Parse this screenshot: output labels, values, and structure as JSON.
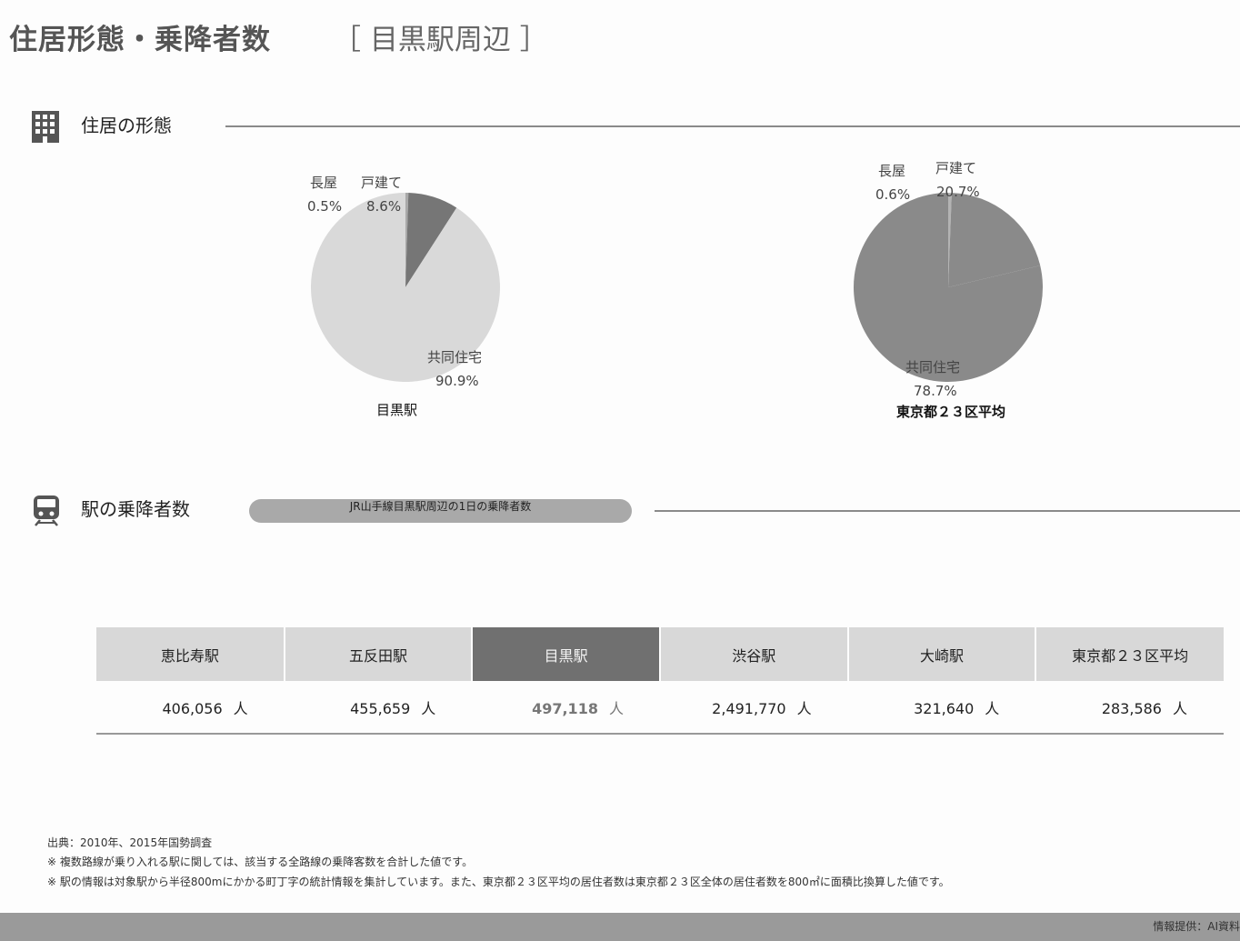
{
  "page": {
    "title": "住居形態・乗降者数",
    "subtitle": "［ 目黒駅周辺 ］"
  },
  "housing_section": {
    "title": "住居の形態",
    "icon": "building-icon"
  },
  "ridership_section": {
    "title": "駅の乗降者数",
    "icon": "train-icon",
    "pill_label": "JR山手線目黒駅周辺の1日の乗降者数"
  },
  "chart_data": [
    {
      "type": "pie",
      "title": "目黒駅",
      "categories": [
        "長屋",
        "戸建て",
        "共同住宅"
      ],
      "values": [
        0.5,
        8.6,
        90.9
      ],
      "value_labels": [
        "0.5%",
        "8.6%",
        "90.9%"
      ],
      "colors": [
        "#a9a9a9",
        "#767676",
        "#d9d9d9"
      ]
    },
    {
      "type": "pie",
      "title": "東京都２３区平均",
      "categories": [
        "長屋",
        "戸建て",
        "共同住宅"
      ],
      "values": [
        0.6,
        20.7,
        78.7
      ],
      "value_labels": [
        "0.6%",
        "20.7%",
        "78.7%"
      ],
      "colors": [
        "#b3b3b3",
        "#8a8a8a",
        "#8a8a8a"
      ]
    },
    {
      "type": "table",
      "columns": [
        "恵比寿駅",
        "五反田駅",
        "目黒駅",
        "渋谷駅",
        "大崎駅",
        "東京都２３区平均"
      ],
      "values": [
        "406,056",
        "455,659",
        "497,118",
        "2,491,770",
        "321,640",
        "283,586"
      ],
      "unit": "人",
      "highlight": "目黒駅"
    }
  ],
  "notes": [
    "出典：2010年、2015年国勢調査",
    "※ 複数路線が乗り入れる駅に関しては、該当する全路線の乗降客数を合計した値です。",
    "※ 駅の情報は対象駅から半径800mにかかる町丁字の統計情報を集計しています。また、東京都２３区平均の居住者数は東京都２３区全体の居住者数を800㎡に面積比換算した値です。"
  ],
  "footer": {
    "credit": "情報提供：AI資料"
  }
}
